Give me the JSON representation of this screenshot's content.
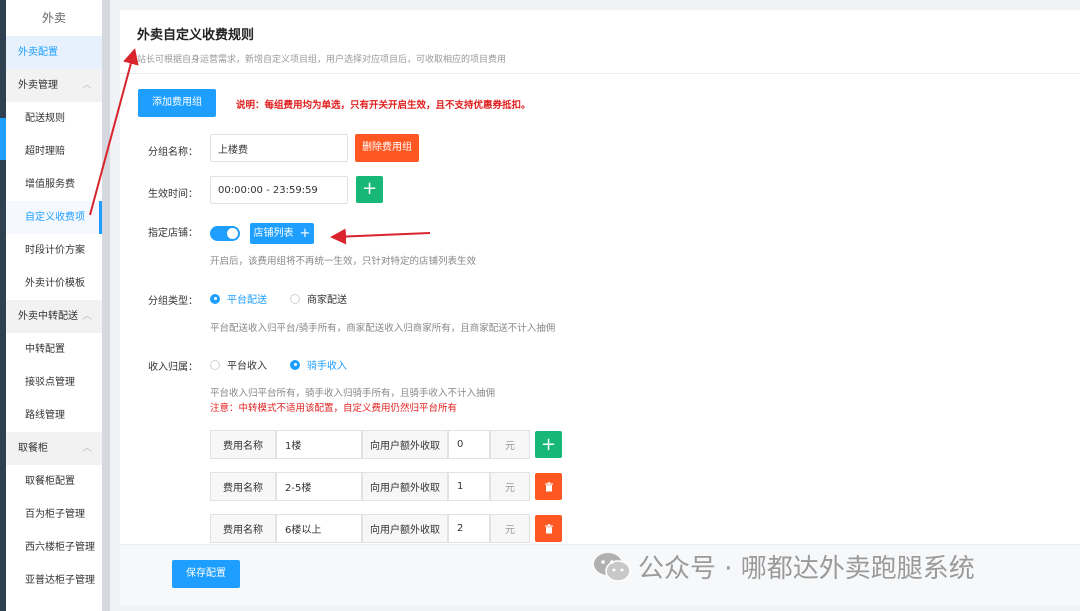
{
  "sidebar": {
    "title": "外卖",
    "items": [
      {
        "type": "top",
        "label": "外卖配置",
        "state": "active"
      },
      {
        "type": "group",
        "label": "外卖管理"
      },
      {
        "type": "sub",
        "label": "配送规则"
      },
      {
        "type": "sub",
        "label": "超时理赔"
      },
      {
        "type": "sub",
        "label": "增值服务费"
      },
      {
        "type": "sub",
        "label": "自定义收费项",
        "state": "current"
      },
      {
        "type": "sub",
        "label": "时段计价方案"
      },
      {
        "type": "sub",
        "label": "外卖计价模板"
      },
      {
        "type": "group",
        "label": "外卖中转配送"
      },
      {
        "type": "sub",
        "label": "中转配置"
      },
      {
        "type": "sub",
        "label": "接驳点管理"
      },
      {
        "type": "sub",
        "label": "路线管理"
      },
      {
        "type": "group",
        "label": "取餐柜"
      },
      {
        "type": "sub",
        "label": "取餐柜配置"
      },
      {
        "type": "sub",
        "label": "百为柜子管理"
      },
      {
        "type": "sub",
        "label": "西六楼柜子管理"
      },
      {
        "type": "sub",
        "label": "亚普达柜子管理"
      }
    ]
  },
  "page": {
    "title": "外卖自定义收费规则",
    "description": "站长可根据自身运营需求，新增自定义项目组，用户选择对应项目后，可收取相应的项目费用"
  },
  "toolbar": {
    "add_group_label": "添加费用组",
    "note": "说明：每组费用均为单选，只有开关开启生效，且不支持优惠券抵扣。"
  },
  "form": {
    "group_name_label": "分组名称：",
    "group_name_value": "上楼费",
    "delete_group_label": "删除费用组",
    "time_label": "生效时间：",
    "time_value": "00:00:00 - 23:59:59",
    "add_time_symbol": "+",
    "store_label": "指定店铺：",
    "store_toggle_on": true,
    "store_list_label": "店铺列表",
    "store_list_symbol": "+",
    "store_help": "开启后，该费用组将不再统一生效，只针对特定的店铺列表生效",
    "type_label": "分组类型：",
    "type_options": [
      "平台配送",
      "商家配送"
    ],
    "type_selected": "平台配送",
    "type_help": "平台配送收入归平台/骑手所有，商家配送收入归商家所有，且商家配送不计入抽佣",
    "income_label": "收入归属：",
    "income_options": [
      "平台收入",
      "骑手收入"
    ],
    "income_selected": "骑手收入",
    "income_help": "平台收入归平台所有，骑手收入归骑手所有，且骑手收入不计入抽佣",
    "income_warning": "注意：中转模式不适用该配置，自定义费用仍然归平台所有"
  },
  "fees": {
    "name_label": "费用名称",
    "charge_label": "向用户额外收取",
    "unit": "元",
    "add_symbol": "+",
    "delete_icon": "trash-icon",
    "rows": [
      {
        "name": "1楼",
        "amount": "0",
        "action": "add"
      },
      {
        "name": "2-5楼",
        "amount": "1",
        "action": "delete"
      },
      {
        "name": "6楼以上",
        "amount": "2",
        "action": "delete"
      }
    ]
  },
  "footer": {
    "save_label": "保存配置"
  },
  "watermark": {
    "text": "公众号 · 哪都达外卖跑腿系统"
  },
  "colors": {
    "primary": "#1e9fff",
    "danger": "#ff5722",
    "success": "#16b777",
    "annotation_arrow": "#d9232d",
    "sidebar_dark": "#2f4050"
  }
}
